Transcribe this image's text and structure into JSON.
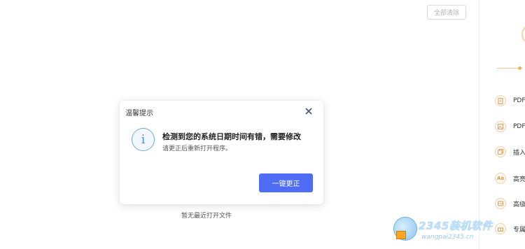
{
  "toolbar": {
    "clear_all_label": "全部清除"
  },
  "main": {
    "empty_text": "暂无最近打开文件"
  },
  "right_panel": {
    "items": [
      {
        "label": "PDF",
        "icon": "document-icon"
      },
      {
        "label": "PDF",
        "icon": "image-icon"
      },
      {
        "label": "插入",
        "icon": "copy-icon"
      },
      {
        "label": "高亮",
        "icon": "font-icon"
      },
      {
        "label": "高级",
        "icon": "layers-icon"
      },
      {
        "label": "专属",
        "icon": "gift-icon"
      }
    ]
  },
  "dialog": {
    "title": "温馨提示",
    "message": "检测到您的系统日期时间有错，需要修改",
    "submessage": "请更正后重新打开程序。",
    "button_label": "一键更正",
    "info_glyph": "i"
  },
  "watermark": {
    "title": "2345装机软件",
    "url": "wangpai2345.cn"
  },
  "colors": {
    "primary_button": "#4f6cf5",
    "info_icon": "#4f8fde",
    "accent_orange": "#f0b060"
  }
}
